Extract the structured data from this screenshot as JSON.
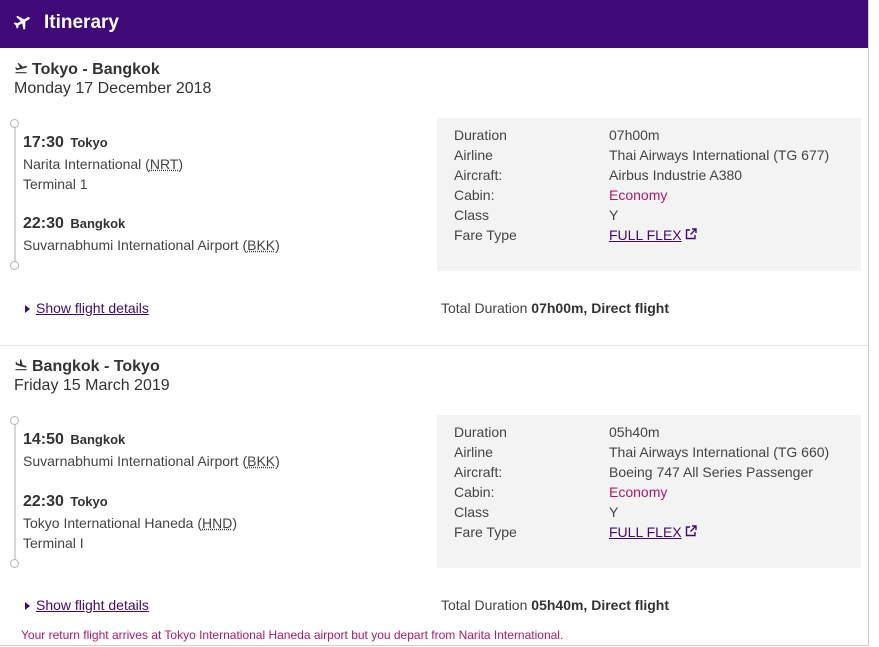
{
  "header": {
    "title": "Itinerary",
    "icon": "plane-icon",
    "color": "#3f0a78"
  },
  "segments": [
    {
      "route": "Tokyo - Bangkok",
      "date": "Monday 17 December 2018",
      "departure": {
        "time": "17:30",
        "city": "Tokyo",
        "airport": "Narita International (",
        "code": "NRT",
        "close": ")",
        "terminal": "Terminal 1"
      },
      "arrival": {
        "time": "22:30",
        "city": "Bangkok",
        "airport": "Suvarnabhumi International Airport (",
        "code": "BKK",
        "close": ")"
      },
      "info": {
        "duration_label": "Duration",
        "duration": "07h00m",
        "airline_label": "Airline",
        "airline": "Thai Airways International (TG 677)",
        "aircraft_label": "Aircraft:",
        "aircraft": "Airbus Industrie A380",
        "cabin_label": "Cabin:",
        "cabin": "Economy",
        "class_label": "Class",
        "class": "Y",
        "fare_label": "Fare Type",
        "fare": "FULL FLEX"
      },
      "show_details": "Show flight details",
      "total_label": "Total Duration ",
      "total_value": "07h00m, Direct flight"
    },
    {
      "route": "Bangkok - Tokyo",
      "date": "Friday 15 March 2019",
      "departure": {
        "time": "14:50",
        "city": "Bangkok",
        "airport": "Suvarnabhumi International Airport (",
        "code": "BKK",
        "close": ")"
      },
      "arrival": {
        "time": "22:30",
        "city": "Tokyo",
        "airport": "Tokyo International Haneda (",
        "code": "HND",
        "close": ")",
        "terminal": "Terminal I"
      },
      "info": {
        "duration_label": "Duration",
        "duration": "05h40m",
        "airline_label": "Airline",
        "airline": "Thai Airways International (TG 660)",
        "aircraft_label": "Aircraft:",
        "aircraft": "Boeing 747 All Series Passenger",
        "cabin_label": "Cabin:",
        "cabin": "Economy",
        "class_label": "Class",
        "class": "Y",
        "fare_label": "Fare Type",
        "fare": "FULL FLEX"
      },
      "show_details": "Show flight details",
      "total_label": "Total Duration ",
      "total_value": "05h40m, Direct flight"
    }
  ],
  "warning": "Your return flight arrives at Tokyo International Haneda airport but you depart from Narita International.",
  "colors": {
    "accent": "#3f0a78",
    "cabin": "#b2186a",
    "warning": "#b2186a"
  }
}
